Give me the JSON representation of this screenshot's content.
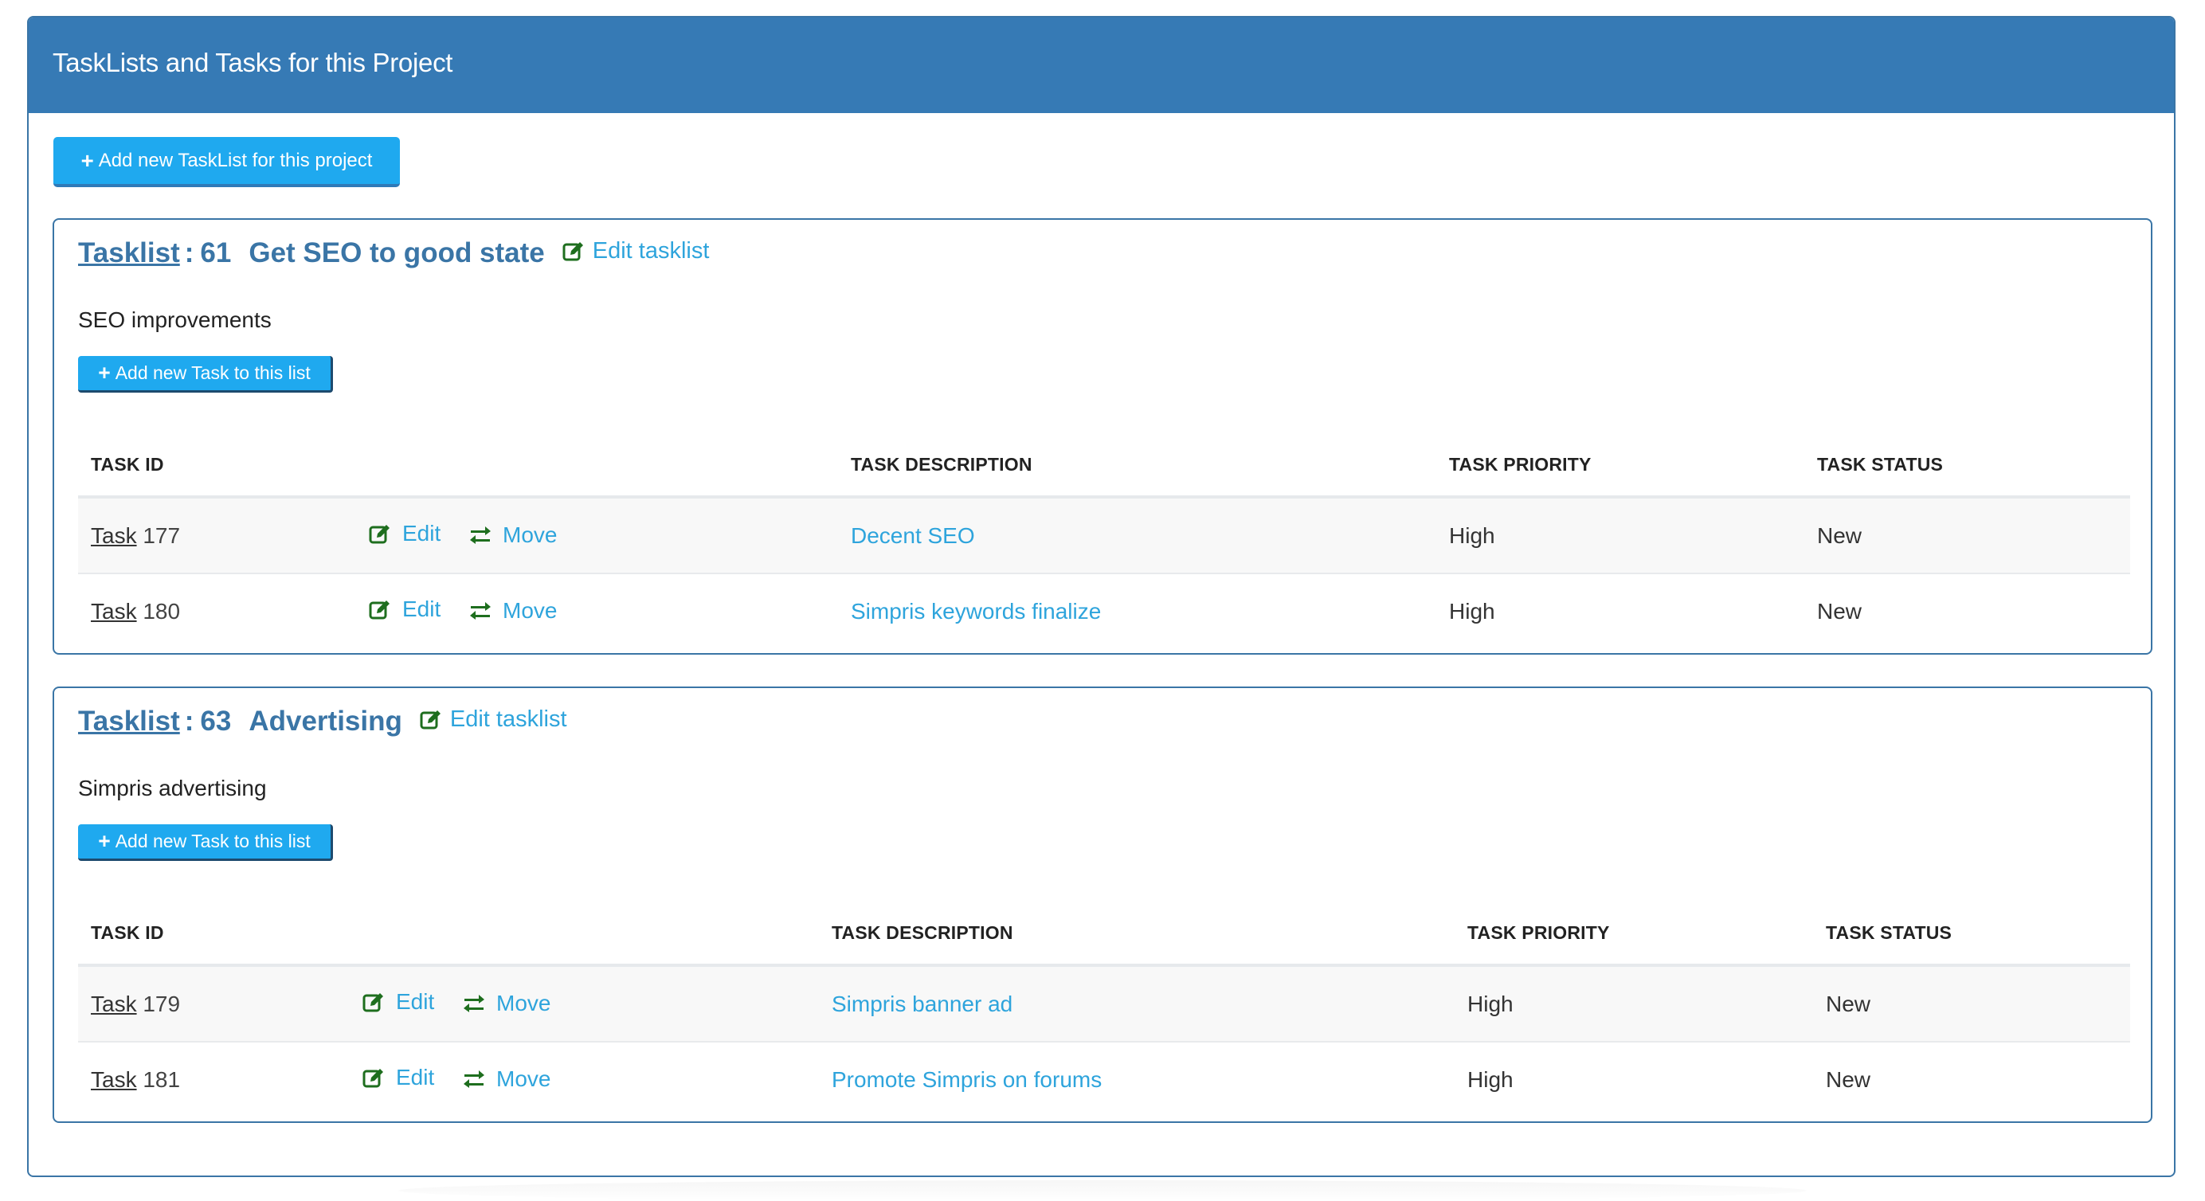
{
  "panel": {
    "title": "TaskLists and Tasks for this Project",
    "add_tasklist_button": "Add new TaskList for this project"
  },
  "colors": {
    "header_bg": "#367ab5",
    "button_bg": "#1fa9ef",
    "link": "#2ea4dc",
    "icon_green": "#1e6e1e",
    "tasklist_heading": "#3a75a6"
  },
  "tasklists": [
    {
      "link_label": "Tasklist",
      "separator": ":",
      "id": "61",
      "name": "Get SEO to good state",
      "edit_label": "Edit tasklist",
      "description": "SEO improvements",
      "add_task_button": "Add new Task to this list",
      "columns": [
        "TASK ID",
        "",
        "TASK DESCRIPTION",
        "TASK PRIORITY",
        "TASK STATUS"
      ],
      "tasks": [
        {
          "task_word": "Task",
          "id": "177",
          "edit_label": "Edit",
          "move_label": "Move",
          "description": "Decent SEO",
          "priority": "High",
          "status": "New"
        },
        {
          "task_word": "Task",
          "id": "180",
          "edit_label": "Edit",
          "move_label": "Move",
          "description": "Simpris keywords finalize",
          "priority": "High",
          "status": "New"
        }
      ]
    },
    {
      "link_label": "Tasklist",
      "separator": ":",
      "id": "63",
      "name": "Advertising",
      "edit_label": "Edit tasklist",
      "description": "Simpris advertising",
      "add_task_button": "Add new Task to this list",
      "columns": [
        "TASK ID",
        "",
        "TASK DESCRIPTION",
        "TASK PRIORITY",
        "TASK STATUS"
      ],
      "tasks": [
        {
          "task_word": "Task",
          "id": "179",
          "edit_label": "Edit",
          "move_label": "Move",
          "description": "Simpris banner ad",
          "priority": "High",
          "status": "New"
        },
        {
          "task_word": "Task",
          "id": "181",
          "edit_label": "Edit",
          "move_label": "Move",
          "description": "Promote Simpris on forums",
          "priority": "High",
          "status": "New"
        }
      ]
    }
  ],
  "icons": {
    "plus": "plus-icon",
    "edit": "edit-icon",
    "move": "exchange-arrows-icon"
  }
}
